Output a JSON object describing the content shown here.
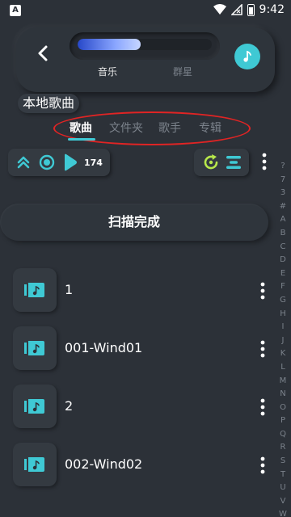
{
  "status_bar": {
    "notification_icon": "A",
    "time": "9:42",
    "icons": [
      "wifi-icon",
      "signal-icon",
      "battery-icon"
    ]
  },
  "header": {
    "slider_progress": 0.47,
    "mode_music": "音乐",
    "mode_star": "群星",
    "accent_color": "#3fc9d4"
  },
  "page_title": "本地歌曲",
  "tabs": [
    {
      "label": "歌曲",
      "active": true
    },
    {
      "label": "文件夹",
      "active": false
    },
    {
      "label": "歌手",
      "active": false
    },
    {
      "label": "专辑",
      "active": false
    }
  ],
  "toolbar": {
    "song_count": "174",
    "left_icons": [
      "collapse-up-icon",
      "locate-icon",
      "play-icon"
    ],
    "right_icons": [
      "refresh-icon",
      "sort-icon"
    ]
  },
  "scan_status": "扫描完成",
  "songs": [
    {
      "title": "1"
    },
    {
      "title": "001-Wind01"
    },
    {
      "title": "2"
    },
    {
      "title": "002-Wind02"
    }
  ],
  "alphabet_index": [
    "?",
    "7",
    "3",
    "#",
    "A",
    "B",
    "C",
    "D",
    "E",
    "F",
    "G",
    "H",
    "I",
    "J",
    "K",
    "L",
    "M",
    "N",
    "O",
    "P",
    "Q",
    "R",
    "S",
    "T",
    "U",
    "V",
    "W"
  ]
}
